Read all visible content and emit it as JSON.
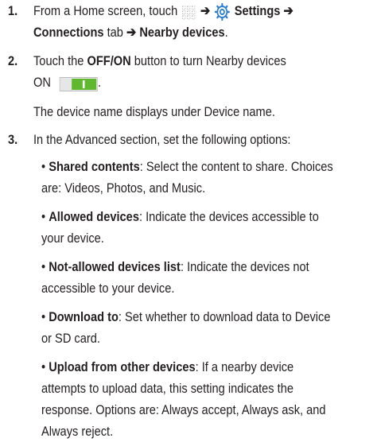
{
  "steps": [
    {
      "number": "1.",
      "line1_prefix": "From a Home screen, touch",
      "arrow": "➔",
      "settings_label": "Settings",
      "line2_connections": "Connections",
      "line2_tab": "tab",
      "line2_nearby": "Nearby devices",
      "line2_end": ".",
      "icons": [
        "apps-icon",
        "settings-gear-icon"
      ]
    },
    {
      "number": "2.",
      "line1_pre": "Touch the",
      "offon": "OFF/ON",
      "line1_post": "button to turn Nearby devices",
      "line2_on": "ON",
      "line2_end": ".",
      "line3": "The device name displays under Device name.",
      "toggle_state": "on",
      "toggle_color": "#5fb82d"
    },
    {
      "number": "3.",
      "intro": "In the Advanced section, set the following options:",
      "bullet_char": "•",
      "options": [
        {
          "term": "Shared contents",
          "lines": [
            ": Select the content to share. Choices",
            "are: Videos, Photos, and Music."
          ]
        },
        {
          "term": "Allowed devices",
          "lines": [
            ": Indicate the devices accessible to",
            "your device."
          ]
        },
        {
          "term": "Not-allowed devices list",
          "lines": [
            ": Indicate the devices not",
            "accessible to your device."
          ]
        },
        {
          "term": "Download to",
          "lines": [
            ": Set whether to download data to Device",
            "or SD card."
          ]
        },
        {
          "term": "Upload from other devices",
          "lines": [
            ": If a nearby device",
            "attempts to upload data, this setting indicates the",
            "response. Options are: Always accept, Always ask, and",
            "Always reject."
          ]
        }
      ]
    }
  ]
}
